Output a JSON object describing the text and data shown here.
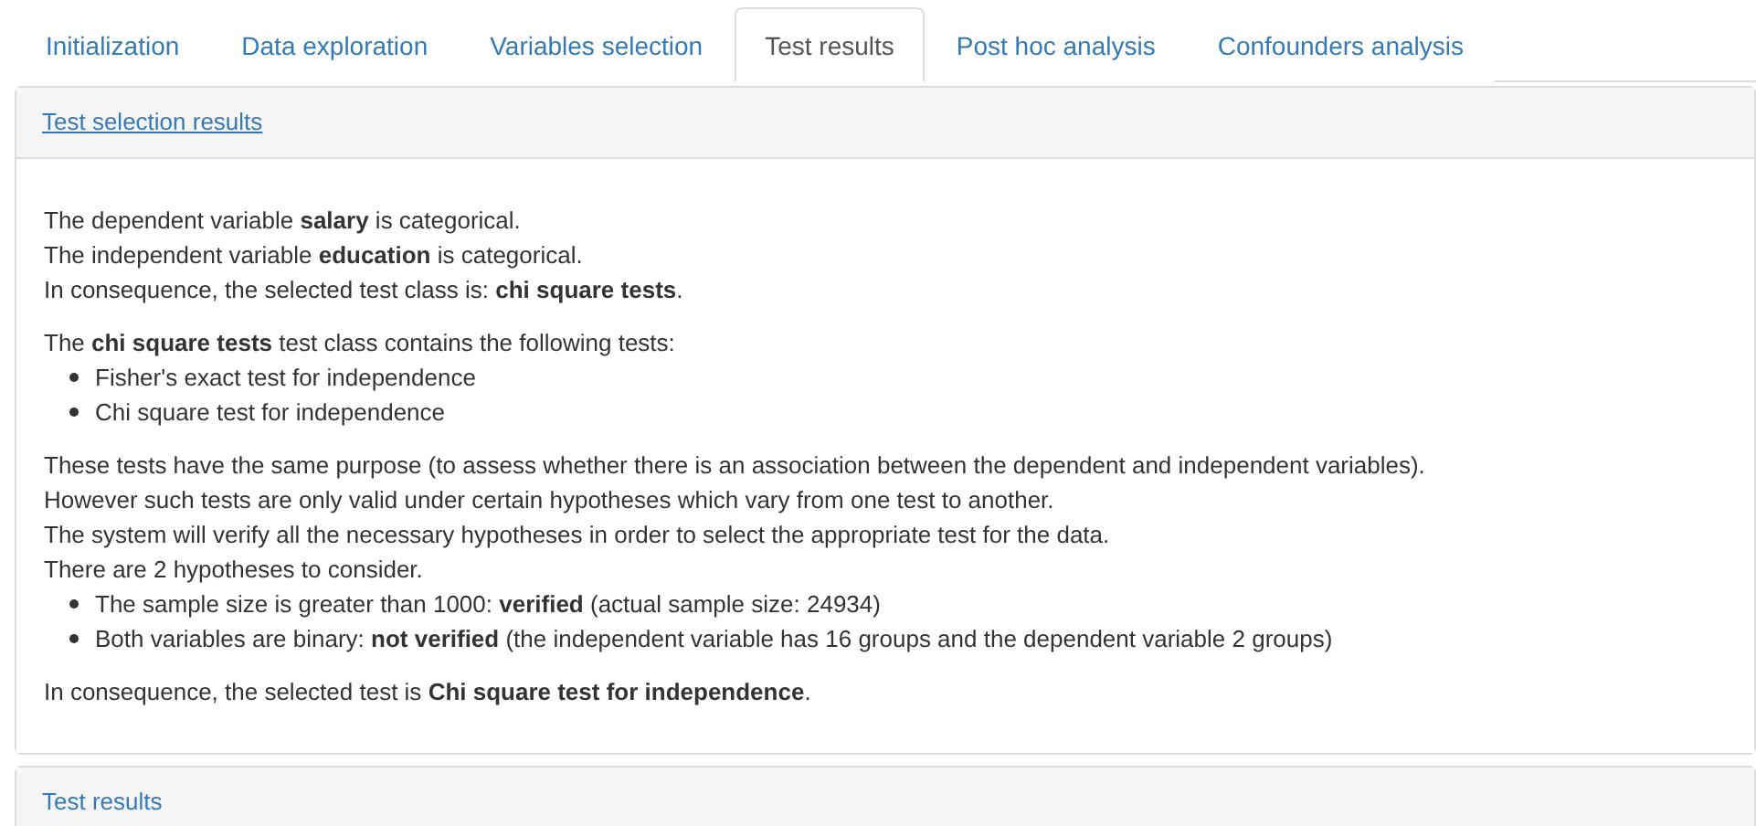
{
  "tabs": [
    {
      "label": "Initialization",
      "selected": false
    },
    {
      "label": "Data exploration",
      "selected": false
    },
    {
      "label": "Variables selection",
      "selected": false
    },
    {
      "label": "Test results",
      "selected": true
    },
    {
      "label": "Post hoc analysis",
      "selected": false
    },
    {
      "label": "Confounders analysis",
      "selected": false
    }
  ],
  "panels": [
    {
      "title": "Test selection results",
      "underlined": true,
      "blocks": [
        {
          "lines": [
            "The dependent variable **salary** is categorical.",
            "The independent variable **education** is categorical.",
            "In consequence, the selected test class is: **chi square tests**."
          ]
        },
        {
          "lines": [
            "The **chi square tests** test class contains the following tests:"
          ],
          "bullets": [
            "Fisher's exact test for independence",
            "Chi square test for independence"
          ]
        },
        {
          "lines": [
            "These tests have the same purpose (to assess whether there is an association between the dependent and independent variables).",
            "However such tests are only valid under certain hypotheses which vary from one test to another.",
            "The system will verify all the necessary hypotheses in order to select the appropriate test for the data.",
            "There are 2 hypotheses to consider."
          ],
          "bullets": [
            "The sample size is greater than 1000: **verified** (actual sample size: 24934)",
            "Both variables are binary: **not verified** (the independent variable has 16 groups and the dependent variable 2 groups)"
          ]
        },
        {
          "lines": [
            "In consequence, the selected test is **Chi square test for independence**."
          ]
        }
      ]
    },
    {
      "title": "Test results",
      "underlined": false
    }
  ]
}
